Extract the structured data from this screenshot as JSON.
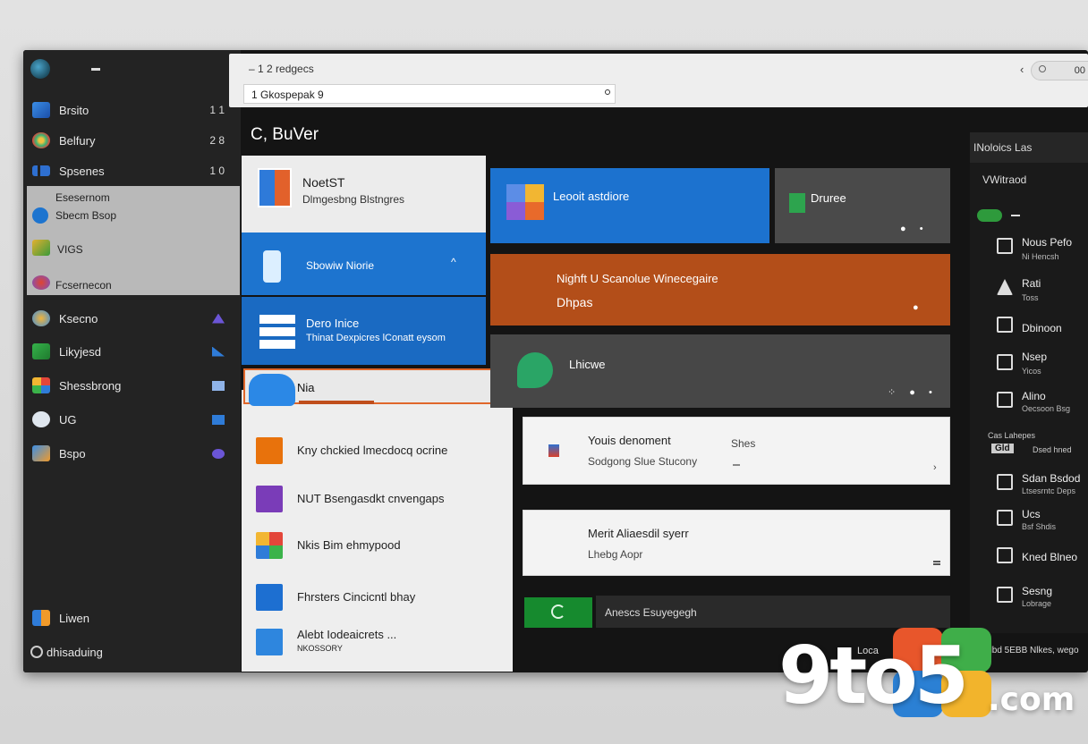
{
  "header": {
    "title": "– 1 2 redgecs",
    "search_value": "1 Gkospepak 9",
    "back_glyph": "‹",
    "pill_value": "00"
  },
  "sidebar": {
    "items": [
      {
        "label": "Brsito",
        "count": "1 1",
        "icon": "stacked-squares-icon"
      },
      {
        "label": "Belfury",
        "count": "2 8",
        "icon": "flower-icon"
      },
      {
        "label": "Spsenes",
        "count": "1 0",
        "icon": "bars-icon"
      }
    ],
    "group": {
      "line1": "Esesernom",
      "line2": "Sbecm Bsop",
      "item": "VIGS",
      "footer": "Fcsernecon"
    },
    "apps": [
      {
        "label": "Ksecno",
        "icon": "globe-icon"
      },
      {
        "label": "Likyjesd",
        "icon": "app-icon"
      },
      {
        "label": "Shessbrong",
        "icon": "app-icon"
      },
      {
        "label": "UG",
        "icon": "cloud-icon"
      },
      {
        "label": "Bspo",
        "icon": "folder-icon"
      }
    ],
    "bottom": [
      {
        "label": "Liwen",
        "icon": "apps-icon"
      },
      {
        "label": "dhisaduing",
        "icon": "gear-icon"
      }
    ]
  },
  "section_title": "C, BuVer",
  "left_panel": {
    "card1": {
      "title": "NoetST",
      "subtitle": "Dlmgesbng Blstngres"
    },
    "card2": {
      "label": "Sbowiw Niorie",
      "chevron": "^"
    },
    "card3": {
      "title": "Dero Inice",
      "subtitle": "Thinat Dexpicres lConatt eysom"
    },
    "selected": {
      "label": "Nia"
    },
    "rows": [
      {
        "label": "Kny chckied lmecdocq ocrine",
        "color": "#e8720c"
      },
      {
        "label": "NUT Bsengasdkt cnvengaps",
        "color": "#7a3cb8"
      },
      {
        "label": "Nkis Bim ehmypood",
        "color": "#3a8d2e"
      },
      {
        "label": "Fhrsters Cincicntl bhay",
        "color": "#1d6fd1"
      },
      {
        "label": "Alebt Iodeaicrets ...",
        "sublabel": "NKOSSORY",
        "color": "#2e86de"
      }
    ]
  },
  "tiles": {
    "blue": {
      "label": "Leooit astdiore",
      "color": "#1c72cf"
    },
    "gray1": {
      "label": "Druree",
      "color": "#4a4a4a"
    },
    "orange": {
      "line1": "Nighft U Scanolue Winecegaire",
      "line2": "Dhpas",
      "color": "#b34e19"
    },
    "gray2": {
      "label": "Lhicwe",
      "color": "#474747"
    },
    "white1": {
      "title": "Youis denoment",
      "subtitle": "Sodgong Slue Stucony",
      "side": "Shes"
    },
    "white2": {
      "title": "Merit Aliaesdil syerr",
      "subtitle": "Lhebg Aopr"
    },
    "bar": {
      "label": "Anescs Esuyegegh"
    }
  },
  "right_panel": {
    "header": "INoloics Las",
    "section": "VWitraod",
    "items": [
      {
        "a": "Nous Pefo",
        "b": "Ni Hencsh",
        "icon": "printer-icon"
      },
      {
        "a": "Rati",
        "b": "Toss",
        "icon": "triangle-icon"
      },
      {
        "a": "Dbinoon",
        "b": "",
        "icon": "calculator-icon"
      },
      {
        "a": "Nsep",
        "b": "Yicos",
        "icon": "monitor-icon"
      },
      {
        "a": "Alino",
        "b": "Oecsoon Bsg",
        "icon": "phone-icon"
      }
    ],
    "group": {
      "title": "Cas Lahepes",
      "badge": "Gld",
      "value": "Dsed hned"
    },
    "items2": [
      {
        "a": "Sdan Bsdod",
        "b": "Ltsesrntc Deps",
        "icon": "grid-icon"
      },
      {
        "a": "Ucs",
        "b": "Bsf Shdis",
        "icon": "grid-icon"
      },
      {
        "a": "Kned Blneo",
        "b": "",
        "icon": "pen-icon"
      },
      {
        "a": "Sesng",
        "b": "Lobrage",
        "icon": "screen-icon"
      }
    ],
    "footer": "Ndbd 5EBB Nlkes, wego",
    "bottom_left": "Loca"
  },
  "watermark": {
    "brand": "9to5",
    "domain": ".com"
  }
}
